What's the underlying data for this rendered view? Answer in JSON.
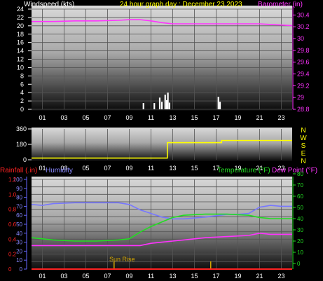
{
  "header": {
    "title": "24 hour graph day : December 23 2023"
  },
  "x_ticks": [
    "01",
    "03",
    "05",
    "07",
    "09",
    "11",
    "13",
    "15",
    "17",
    "19",
    "21",
    "23"
  ],
  "wind": {
    "label": "Windspeed (kts)",
    "ylim": [
      0,
      24
    ],
    "yticks": [
      0,
      2,
      4,
      6,
      8,
      10,
      12,
      14,
      16,
      18,
      20,
      22,
      24
    ],
    "color": "#ffffff"
  },
  "barometer": {
    "label": "Barometer (in)",
    "ylim": [
      28.8,
      30.5
    ],
    "yticks": [
      "28.8",
      "29",
      "29.2",
      "29.4",
      "29.6",
      "29.8",
      "30",
      "30.2",
      "30.4"
    ],
    "color": "#ff33ff"
  },
  "direction": {
    "yticks": [
      "0",
      "180",
      "360"
    ],
    "compass": [
      "N",
      "W",
      "S",
      "E",
      "N"
    ],
    "color": "#ffff00"
  },
  "bottom": {
    "rainfall_label": "Rainfall (.in)",
    "humidity_label": "Humidity",
    "temperature_label": "Temperature (°F)",
    "dewpoint_label": "Dew Point (°F)",
    "left_ticks": [
      "0",
      "0.2",
      "0.4",
      "0.6",
      "0.8",
      "1.0",
      "1.2"
    ],
    "humidity_ticks": [
      "0",
      "10",
      "20",
      "30",
      "40",
      "50",
      "60",
      "70",
      "80",
      "90",
      "100"
    ],
    "temp_ticks": [
      "0",
      "10",
      "20",
      "30",
      "40",
      "50",
      "60",
      "70",
      "80"
    ],
    "sunrise_label": "Sun Rise",
    "colors": {
      "rain": "#ff2222",
      "humidity": "#7777ff",
      "temp": "#22dd22",
      "dew": "#ff33ff",
      "sun": "#d6a800"
    }
  },
  "chart_data": [
    {
      "type": "bar",
      "title": "24 hour graph day : December 23 2023",
      "ylabel": "Windspeed (kts)",
      "ylim": [
        0,
        24
      ],
      "series": [
        {
          "name": "Windspeed",
          "points": [
            [
              10.3,
              1.5
            ],
            [
              11.3,
              1.5
            ],
            [
              11.8,
              2.8
            ],
            [
              12.0,
              1.8
            ],
            [
              12.3,
              3.5
            ],
            [
              12.45,
              2.2
            ],
            [
              12.55,
              4.0
            ],
            [
              12.7,
              1.6
            ],
            [
              17.2,
              3.0
            ],
            [
              17.35,
              1.8
            ]
          ]
        }
      ]
    },
    {
      "type": "line",
      "ylabel": "Barometer (in)",
      "ylim": [
        28.8,
        30.5
      ],
      "series": [
        {
          "name": "Barometer",
          "x": [
            0,
            2,
            4,
            6,
            8,
            9,
            10,
            11,
            12,
            13,
            14,
            16,
            18,
            20,
            21,
            22,
            23,
            24
          ],
          "values": [
            30.29,
            30.29,
            30.3,
            30.3,
            30.31,
            30.32,
            30.32,
            30.3,
            30.27,
            30.25,
            30.25,
            30.25,
            30.25,
            30.25,
            30.25,
            30.24,
            30.23,
            30.22
          ]
        }
      ]
    },
    {
      "type": "line",
      "ylim": [
        0,
        360
      ],
      "series": [
        {
          "name": "Wind direction",
          "x": [
            0,
            12.5,
            12.5,
            17.5,
            17.5,
            24
          ],
          "values": [
            20,
            20,
            200,
            200,
            225,
            225
          ]
        }
      ]
    },
    {
      "type": "line",
      "xlabel": "",
      "series": [
        {
          "name": "Humidity",
          "unit": "%",
          "ylim": [
            0,
            100
          ],
          "x": [
            0,
            1,
            2,
            4,
            6,
            8,
            9,
            10,
            11,
            12,
            13,
            14,
            16,
            18,
            19,
            20,
            21,
            22,
            23,
            24
          ],
          "values": [
            72,
            71,
            73,
            74,
            74,
            74,
            72,
            66,
            62,
            58,
            56,
            56,
            58,
            61,
            61,
            62,
            69,
            71,
            70,
            70
          ]
        },
        {
          "name": "Temperature",
          "unit": "°F",
          "ylim": [
            0,
            80
          ],
          "x": [
            0,
            1,
            2,
            4,
            6,
            8,
            9,
            10,
            11,
            12,
            13,
            14,
            16,
            18,
            20,
            21,
            22,
            24
          ],
          "values": [
            23,
            22,
            21,
            20,
            20,
            21,
            22,
            28,
            33,
            37,
            41,
            43,
            44,
            44,
            43,
            41,
            40,
            40
          ]
        },
        {
          "name": "Dew Point",
          "unit": "°F",
          "ylim": [
            0,
            80
          ],
          "x": [
            0,
            1,
            2,
            4,
            6,
            8,
            9,
            10,
            11,
            12,
            13,
            14,
            16,
            18,
            20,
            21,
            22,
            24
          ],
          "values": [
            16,
            16,
            16,
            16,
            16,
            16,
            16,
            16,
            18,
            19,
            20,
            21,
            23,
            24,
            25,
            27,
            26,
            26
          ]
        },
        {
          "name": "Rainfall",
          "unit": "in",
          "ylim": [
            0,
            1.2
          ],
          "x": [
            0,
            24
          ],
          "values": [
            0,
            0
          ]
        }
      ],
      "annotations": [
        {
          "label": "Sun Rise",
          "x": 7.6
        },
        {
          "label": "",
          "x": 16.5
        }
      ]
    }
  ]
}
